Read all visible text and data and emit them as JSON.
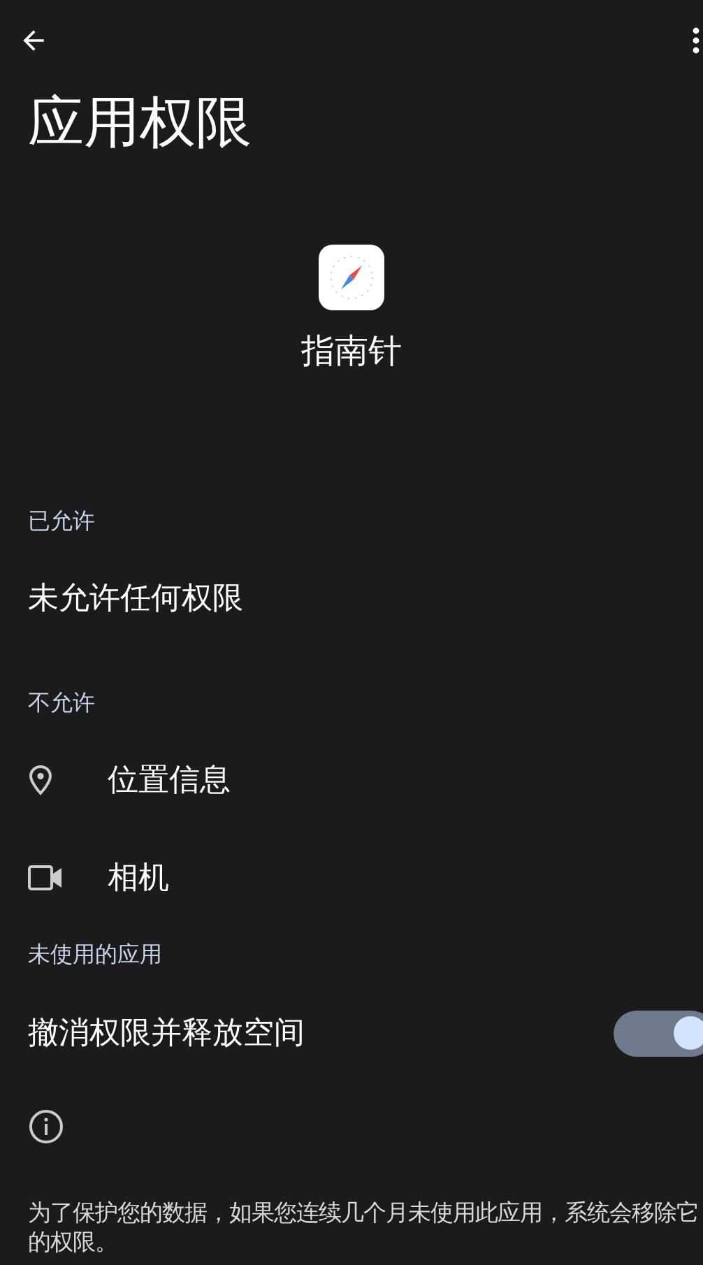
{
  "title": "应用权限",
  "app": {
    "name": "指南针"
  },
  "sections": [
    {
      "header": "已允许",
      "items": [
        {
          "kind": "empty",
          "label": "未允许任何权限"
        }
      ]
    },
    {
      "header": "不允许",
      "items": [
        {
          "kind": "location",
          "label": "位置信息"
        },
        {
          "kind": "camera",
          "label": "相机"
        }
      ]
    }
  ],
  "unused": {
    "header": "未使用的应用",
    "setting": {
      "label": "撤消权限并释放空间",
      "on": true
    },
    "info": "为了保护您的数据，如果您连续几个月未使用此应用，系统会移除它的权限。"
  }
}
